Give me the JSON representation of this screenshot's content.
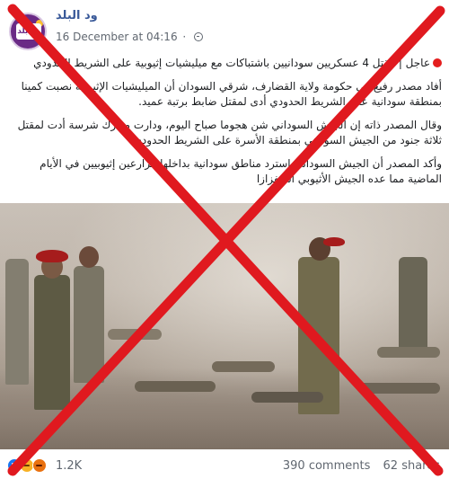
{
  "post": {
    "page_name": "ود البلد",
    "avatar_text": "ود بلد",
    "timestamp": "16 December at 04:16",
    "privacy_icon": "globe-icon",
    "paragraphs": [
      "عاجل | مقتل 4 عسكريين سودانيين باشتباكات مع ميليشيات إثيوبية على الشريط الحدودي",
      "أفاد مصدر رفيع في حكومة ولاية القضارف، شرقي السودان أن الميليشيات الإثيوبية نصبت كمينا بمنطقة سودانية على الشريط الحدودي أدى لمقتل ضابط برتبة عميد.",
      "وقال المصدر ذاته إن الجيش السوداني شن هجوما صباح اليوم، ودارت معارك شرسة أدت لمقتل ثلاثة جنود من الجيش السوداني بمنطقة الأسرة على الشريط الحدودي.",
      "وأكد المصدر أن الجيش السوداني استرد مناطق سودانية بداخلها مزارعين إثيوبيين في الأيام الماضية مما عده الجيش الأثيوبي استفزازا"
    ]
  },
  "photo": {
    "description_icon": "news-photo"
  },
  "overlay": {
    "color": "#e0191f"
  },
  "footer": {
    "reaction_icons": [
      "like-icon",
      "sad-icon",
      "angry-icon"
    ],
    "reaction_count": "1.2K",
    "comments": "390 comments",
    "shares": "62 shares"
  },
  "colors": {
    "link": "#385898",
    "meta": "#606770",
    "like": "#1877f2",
    "sad": "#f7b125",
    "angry": "#e9710f"
  }
}
